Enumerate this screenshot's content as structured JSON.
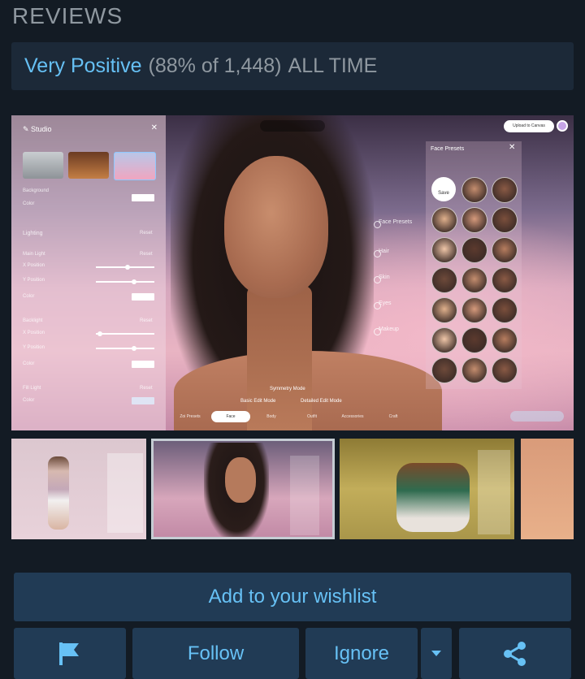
{
  "reviews": {
    "section_title": "REVIEWS",
    "rating_label": "Very Positive",
    "rating_detail": "(88% of 1,448)",
    "rating_period": "ALL TIME"
  },
  "screenshot_ui": {
    "studio_title": "Studio",
    "background_label": "Background",
    "color_label": "Color",
    "lighting_label": "Lighting",
    "reset_label": "Reset",
    "main_light_label": "Main Light",
    "x_position_label": "X Position",
    "y_position_label": "Y Position",
    "backlight_label": "Backlight",
    "fill_light_label": "Fill Light",
    "face_presets_title": "Face Presets",
    "save_label": "Save",
    "upload_label": "Upload to Canvas",
    "side_menu": [
      "Face Presets",
      "Hair",
      "Skin",
      "Eyes",
      "Makeup"
    ],
    "symmetry_mode": "Symmetry Mode",
    "basic_edit_mode": "Basic Edit Mode",
    "detailed_edit_mode": "Detailed Edit Mode",
    "bottom_tabs": [
      "Zoi Presets",
      "Face",
      "Body",
      "Outfit",
      "Accessories",
      "Craft"
    ],
    "active_tab": "Face"
  },
  "actions": {
    "wishlist_label": "Add to your wishlist",
    "follow_label": "Follow",
    "ignore_label": "Ignore"
  },
  "icons": {
    "flag": "flag-icon",
    "dropdown": "chevron-down-icon",
    "share": "share-icon"
  },
  "colors": {
    "background": "#131b24",
    "panel": "#1c2938",
    "button": "#213b55",
    "accent": "#67c1f5",
    "muted_text": "#8f98a0"
  }
}
